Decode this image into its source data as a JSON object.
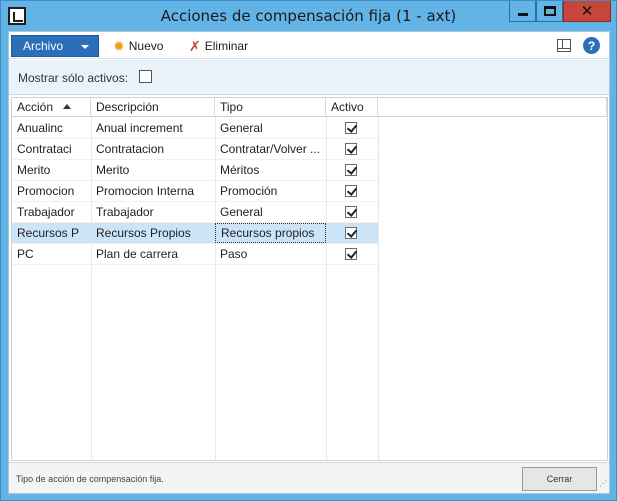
{
  "window": {
    "title": "Acciones de compensación fija (1 - axt)",
    "accent": "#62b3e6",
    "close_color": "#c7463a",
    "icons": [
      "app-icon",
      "minimize-icon",
      "maximize-icon",
      "close-icon"
    ]
  },
  "toolbar": {
    "archivo_label": "Archivo",
    "new_label": "Nuevo",
    "delete_label": "Eliminar",
    "archivo_color": "#2b6fb8"
  },
  "filter": {
    "label": "Mostrar sólo activos:",
    "checked": false
  },
  "grid": {
    "columns": [
      "Acción",
      "Descripción",
      "Tipo",
      "Activo"
    ],
    "sort_column": "Acción",
    "selected_row": 5,
    "rows": [
      {
        "accion": "Anualinc",
        "descripcion": "Anual increment",
        "tipo": "General",
        "activo": true
      },
      {
        "accion": "Contrataci",
        "descripcion": "Contratacion",
        "tipo": "Contratar/Volver ...",
        "activo": true
      },
      {
        "accion": "Merito",
        "descripcion": "Merito",
        "tipo": "Méritos",
        "activo": true
      },
      {
        "accion": "Promocion",
        "descripcion": "Promocion Interna",
        "tipo": "Promoción",
        "activo": true
      },
      {
        "accion": "Trabajador",
        "descripcion": "Trabajador",
        "tipo": "General",
        "activo": true
      },
      {
        "accion": "Recursos P",
        "descripcion": "Recursos Propios",
        "tipo": "Recursos propios",
        "activo": true
      },
      {
        "accion": "PC",
        "descripcion": "Plan de carrera",
        "tipo": "Paso",
        "activo": true
      }
    ]
  },
  "status": {
    "text": "Tipo de acción de compensación fija.",
    "close_label": "Cerrar"
  }
}
